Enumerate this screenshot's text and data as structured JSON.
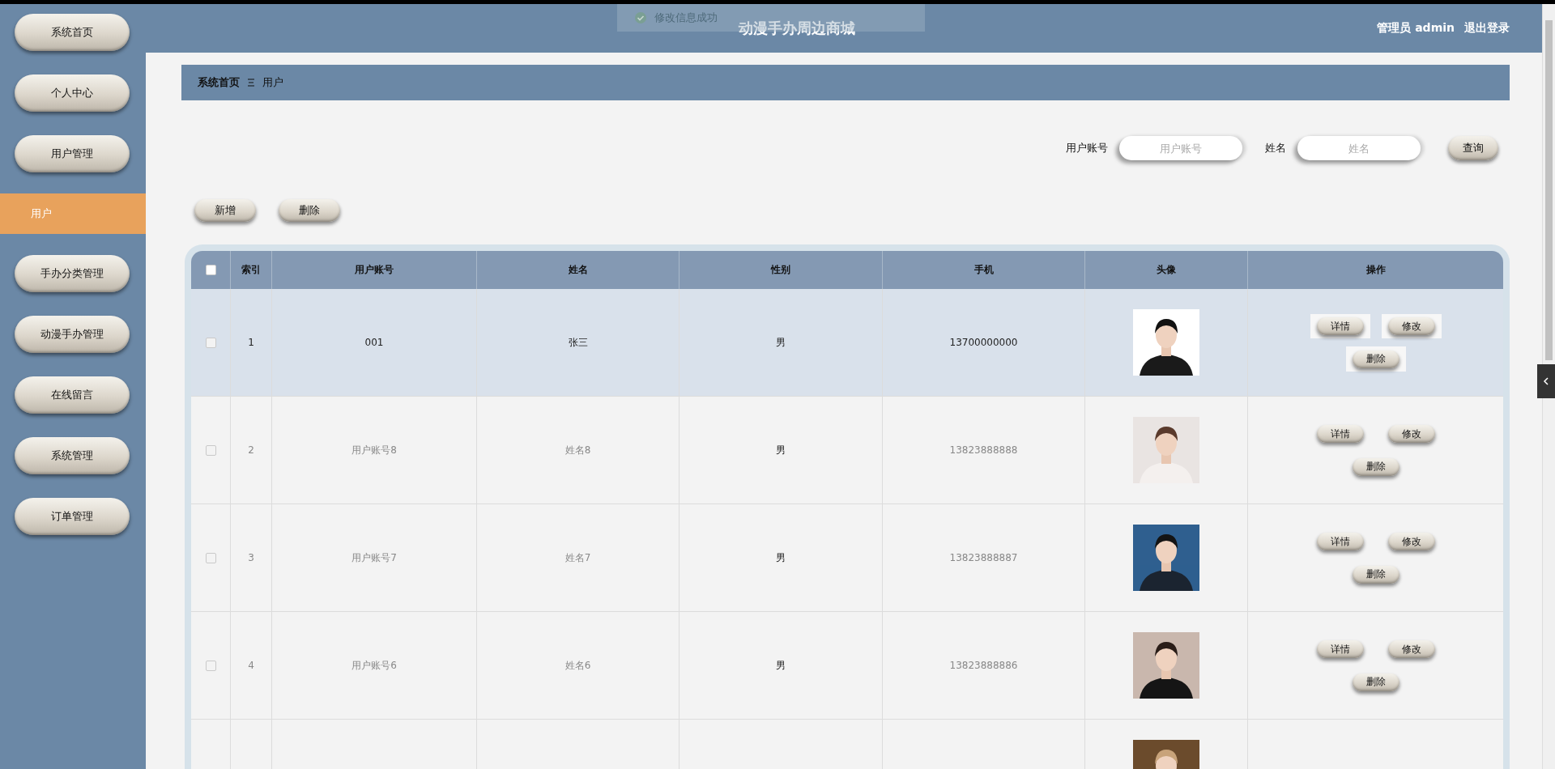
{
  "toast": {
    "message": "修改信息成功"
  },
  "header": {
    "title": "动漫手办周边商城",
    "user": "管理员 admin",
    "logout": "退出登录"
  },
  "sidebar": {
    "items": [
      {
        "label": "系统首页",
        "kind": "menu",
        "selected": false
      },
      {
        "label": "个人中心",
        "kind": "menu",
        "selected": false
      },
      {
        "label": "用户管理",
        "kind": "menu",
        "selected": false
      },
      {
        "label": "用户",
        "kind": "sub",
        "selected": true
      },
      {
        "label": "手办分类管理",
        "kind": "menu",
        "selected": false
      },
      {
        "label": "动漫手办管理",
        "kind": "menu",
        "selected": false
      },
      {
        "label": "在线留言",
        "kind": "menu",
        "selected": false
      },
      {
        "label": "系统管理",
        "kind": "menu",
        "selected": false
      },
      {
        "label": "订单管理",
        "kind": "menu",
        "selected": false
      }
    ]
  },
  "breadcrumb": [
    "系统首页",
    "用户"
  ],
  "search": {
    "fields": [
      {
        "label": "用户账号",
        "placeholder": "用户账号"
      },
      {
        "label": "姓名",
        "placeholder": "姓名"
      }
    ],
    "button": "查询"
  },
  "toolbar": [
    "新增",
    "删除"
  ],
  "table": {
    "header_checked": false,
    "columns": [
      "索引",
      "用户账号",
      "姓名",
      "性别",
      "手机",
      "头像",
      "操作"
    ],
    "rows": [
      {
        "index": "1",
        "account": "001",
        "name": "张三",
        "gender": "男",
        "phone": "13700000000",
        "checked": false,
        "highlighted": true,
        "actions": [
          "详情",
          "修改",
          "删除"
        ]
      },
      {
        "index": "2",
        "account": "用户账号8",
        "name": "姓名8",
        "gender": "男",
        "phone": "13823888888",
        "checked": false,
        "highlighted": false,
        "actions": [
          "详情",
          "修改",
          "删除"
        ]
      },
      {
        "index": "3",
        "account": "用户账号7",
        "name": "姓名7",
        "gender": "男",
        "phone": "13823888887",
        "checked": false,
        "highlighted": false,
        "actions": [
          "详情",
          "修改",
          "删除"
        ]
      },
      {
        "index": "4",
        "account": "用户账号6",
        "name": "姓名6",
        "gender": "男",
        "phone": "13823888886",
        "checked": false,
        "highlighted": false,
        "actions": [
          "详情",
          "修改",
          "删除"
        ]
      },
      {
        "highlighted": false
      }
    ]
  }
}
